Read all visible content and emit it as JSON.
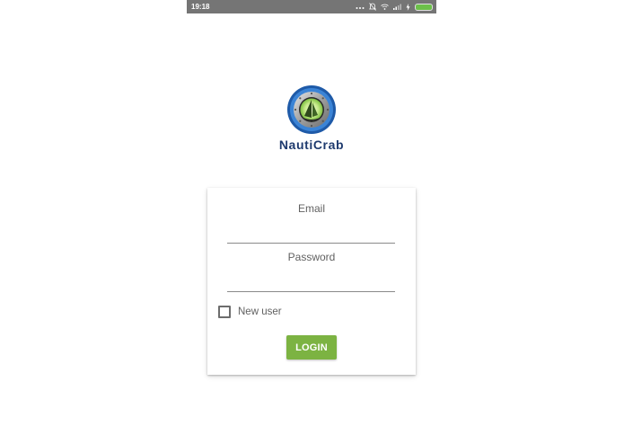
{
  "status_bar": {
    "time": "19:18",
    "icons": [
      "more-icon",
      "notifications-off-icon",
      "wifi-icon",
      "signal-icon",
      "charging-icon",
      "battery-icon"
    ]
  },
  "logo": {
    "text": "NautiCrab"
  },
  "login_form": {
    "email_label": "Email",
    "email_value": "",
    "password_label": "Password",
    "password_value": "",
    "new_user_label": "New user",
    "new_user_checked": false,
    "login_button_label": "LOGIN"
  },
  "colors": {
    "status_bar": "#757575",
    "button": "#7cb342",
    "logo_text": "#1e3a6e",
    "battery": "#6cc04a"
  }
}
